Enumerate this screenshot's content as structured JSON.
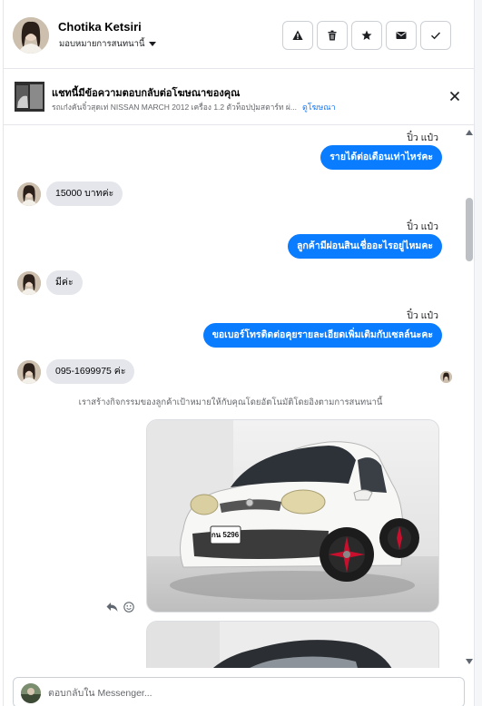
{
  "contact": {
    "name": "Chotika Ketsiri",
    "assign_label": "มอบหมายการสนทนานี้"
  },
  "toolbar": [
    {
      "name": "report-button",
      "icon": "warning-icon"
    },
    {
      "name": "delete-button",
      "icon": "trash-icon"
    },
    {
      "name": "star-button",
      "icon": "star-icon"
    },
    {
      "name": "mark-unread-button",
      "icon": "envelope-icon"
    },
    {
      "name": "mark-done-button",
      "icon": "check-icon"
    }
  ],
  "ad": {
    "title": "แชทนี้มีข้อความตอบกลับต่อโฆษณาของคุณ",
    "subtitle": "รถเก๋งคันจิ๋วสุดเท่ NISSAN MARCH 2012 เครื่อง 1.2 ตัวท็อปปุ่มสตาร์ท ผ่...",
    "link": "ดูโฆษณา"
  },
  "messages": [
    {
      "sender": "ปิ๋ว แป๋ว",
      "text": "รายได้ต่อเดือนเท่าไหร่คะ"
    },
    {
      "text": "15000 บาทค่ะ"
    },
    {
      "sender": "ปิ๋ว แป๋ว",
      "text": "ลูกค้ามีผ่อนสินเชื่ออะไรอยู่ไหมคะ"
    },
    {
      "text": "มีค่ะ"
    },
    {
      "sender": "ปิ๋ว แป๋ว",
      "text": "ขอเบอร์โทรติดต่อคุยรายละเอียดเพิ่มเติมกับเซลล์นะคะ"
    },
    {
      "text": "095-1699975 ค่ะ"
    }
  ],
  "system_note": "เราสร้างกิจกรรมของลูกค้าเป้าหมายให้กับคุณโดยอัตโนมัติโดยอิงตามการสนทนานี้",
  "license_plate": "กน 5296",
  "composer": {
    "placeholder": "ตอบกลับใน Messenger..."
  },
  "colors": {
    "outgoing_bubble": "#0a7cff",
    "incoming_bubble": "#e4e6eb",
    "link": "#1877f2"
  }
}
